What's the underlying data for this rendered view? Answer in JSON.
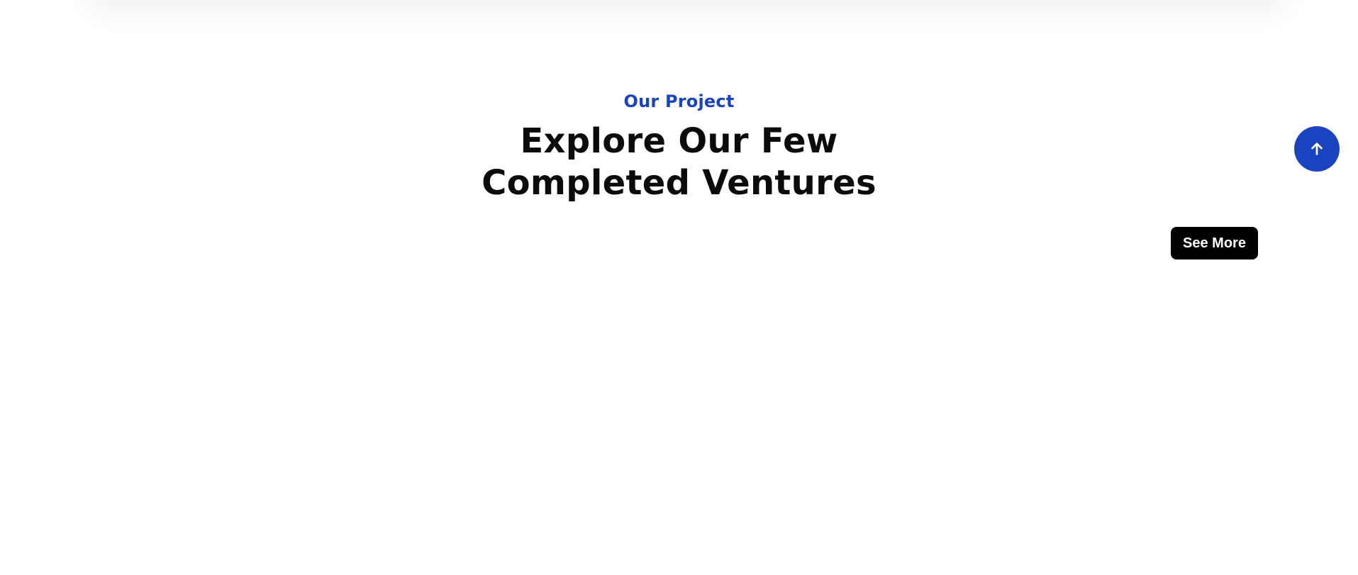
{
  "section": {
    "eyebrow": "Our Project",
    "title": "Explore Our Few Completed Ventures"
  },
  "actions": {
    "see_more_label": "See More"
  },
  "scroll_top": {
    "icon": "arrow-up-icon"
  },
  "colors": {
    "accent": "#1a43c0",
    "button_bg": "#000000",
    "button_text": "#ffffff",
    "heading": "#0b0b0b",
    "background": "#ffffff"
  }
}
